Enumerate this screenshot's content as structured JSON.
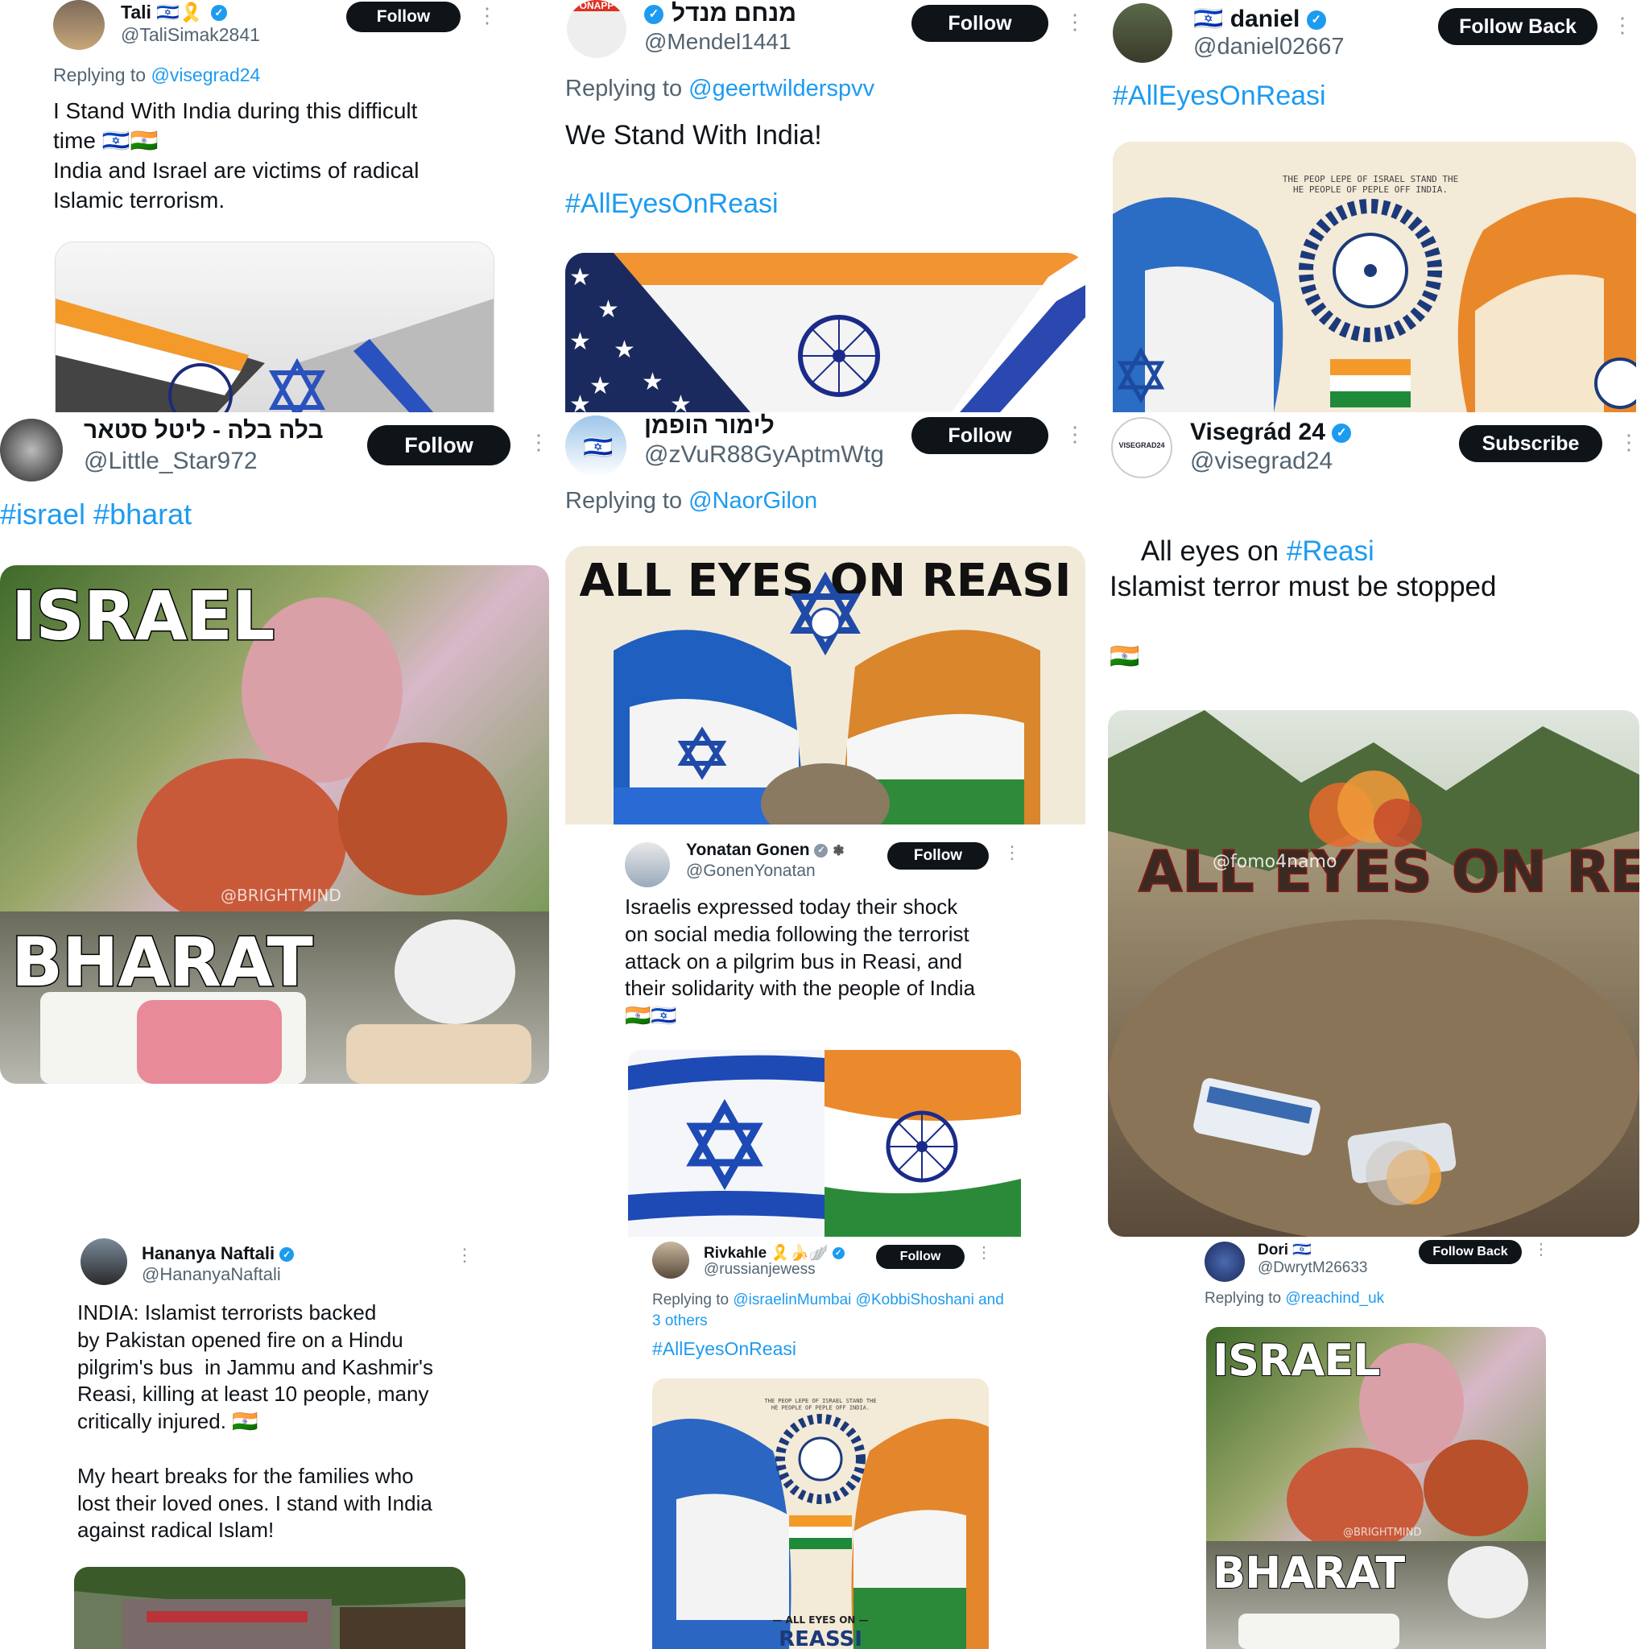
{
  "colors": {
    "accent": "#1d9bf0",
    "button": "#0f1419",
    "text": "#0f1419",
    "muted": "#536471"
  },
  "tweets": [
    {
      "name": "Tali 🇮🇱🎗️",
      "handle": "@TaliSimak2841",
      "button": "Follow",
      "replying_label": "Replying to",
      "replying_to": "@visegrad24",
      "text": "I Stand With India during this difficult\ntime 🇮🇱🇮🇳\nIndia and Israel are victims of radical\nIslamic terrorism."
    },
    {
      "name": "מנחם מנדל",
      "handle": "@Mendel1441",
      "button": "Follow",
      "replying_label": "Replying to",
      "replying_to": "@geertwilderspvv",
      "text": "We Stand With India!",
      "hashtag": "#AllEyesOnReasi",
      "avatar_text": "ONAPP"
    },
    {
      "name": "daniel",
      "handle": "@daniel02667",
      "button": "Follow Back",
      "hashtag": "#AllEyesOnReasi",
      "media_caption": "THE PEOP LEPE OF ISRAEL STAND THE\nHE PEOPLE OF PEPLE OFF INDIA."
    },
    {
      "name": "בלה בלה - ליטל סטאר",
      "handle": "@Little_Star972",
      "button": "Follow",
      "hashtags": "#israel #bharat",
      "media": {
        "top": "ISRAEL",
        "bottom": "BHARAT",
        "watermark": "@BRIGHTMIND"
      }
    },
    {
      "name": "לימור הופמן",
      "handle": "@zVuR88GyAptmWtg",
      "button": "Follow",
      "replying_label": "Replying to",
      "replying_to": "@NaorGilon",
      "media_caption": "ALL EYES ON REASI"
    },
    {
      "name": "Visegrád 24",
      "handle": "@visegrad24",
      "button": "Subscribe",
      "avatar_text": "VISEGRAD24",
      "text_prefix": "All eyes on ",
      "text_tag": "#Reasi",
      "text2": "Islamist terror must be stopped",
      "flag": "🇮🇳",
      "media": {
        "watermark": "@fomo4namo",
        "letters": "ALL EYES ON REASI"
      }
    },
    {
      "name": "Yonatan Gonen",
      "handle": "@GonenYonatan",
      "button": "Follow",
      "text": "Israelis expressed today their shock\non social media following the terrorist\nattack on a pilgrim bus in Reasi, and\ntheir solidarity with the people of India\n🇮🇳🇮🇱"
    },
    {
      "name": "Hananya Naftali",
      "handle": "@HananyaNaftali",
      "text": "INDIA: Islamist terrorists backed\nby Pakistan opened fire on a Hindu\npilgrim's bus  in Jammu and Kashmir's\nReasi, killing at least 10 people, many\ncritically injured. 🇮🇳\n\nMy heart breaks for the families who\nlost their loved ones. I stand with India\nagainst radical Islam!"
    },
    {
      "name": "Rivkahle 🎗️🍌🪽",
      "handle": "@russianjewess",
      "button": "Follow",
      "replying_label": "Replying to",
      "replying_to": "@israelinMumbai @KobbiShoshani and",
      "replying_more": "3 others",
      "hashtag": "#AllEyesOnReasi",
      "media_caption": "THE PEOP LEPE OF ISRAEL STAND THE\nHE PEOPLE OF PEPLE OFF INDIA.",
      "media_bottom": "— ALL EYES ON —",
      "media_bottom2": "REASSI"
    },
    {
      "name": "Dori 🇮🇱",
      "handle": "@DwrytM26633",
      "button": "Follow Back",
      "replying_label": "Replying to",
      "replying_to": "@reachind_uk",
      "media": {
        "top": "ISRAEL",
        "bottom": "BHARAT",
        "watermark": "@BRIGHTMIND"
      }
    }
  ]
}
